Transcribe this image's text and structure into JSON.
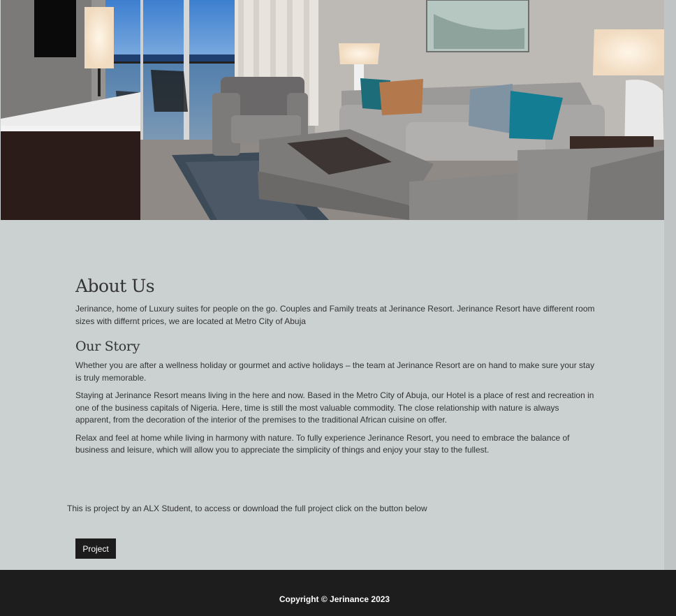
{
  "hero": {
    "image_name": "living-room-suite-photo"
  },
  "about": {
    "title": "About Us",
    "intro": "Jerinance, home of Luxury suites for people on the go. Couples and Family treats at Jerinance Resort. Jerinance Resort have different room sizes with differnt prices, we are located at Metro City of Abuja"
  },
  "story": {
    "title": "Our Story",
    "paragraphs": [
      "Whether you are after a wellness holiday or gourmet and active holidays – the team at Jerinance Resort are on hand to make sure your stay is truly memorable.",
      "Staying at Jerinance Resort means living in the here and now. Based in the Metro City of Abuja, our Hotel is a place of rest and recreation in one of the business capitals of Nigeria. Here, time is still the most valuable commodity. The close relationship with nature is always apparent, from the decoration of the interior of the premises to the traditional African cuisine on offer.",
      "Relax and feel at home while living in harmony with nature. To fully experience Jerinance Resort, you need to embrace the balance of business and leisure, which will allow you to appreciate the simplicity of things and enjoy your stay to the fullest."
    ]
  },
  "project": {
    "note": "This is project by an ALX Student, to access or download the full project click on the button below",
    "button_label": "Project"
  },
  "footer": {
    "copyright": "Copyright © Jerinance 2023"
  },
  "colors": {
    "page_background": "#cbd0d0",
    "footer_background": "#1d1d1d",
    "button_background": "#1c1c1c",
    "text": "#333333"
  }
}
